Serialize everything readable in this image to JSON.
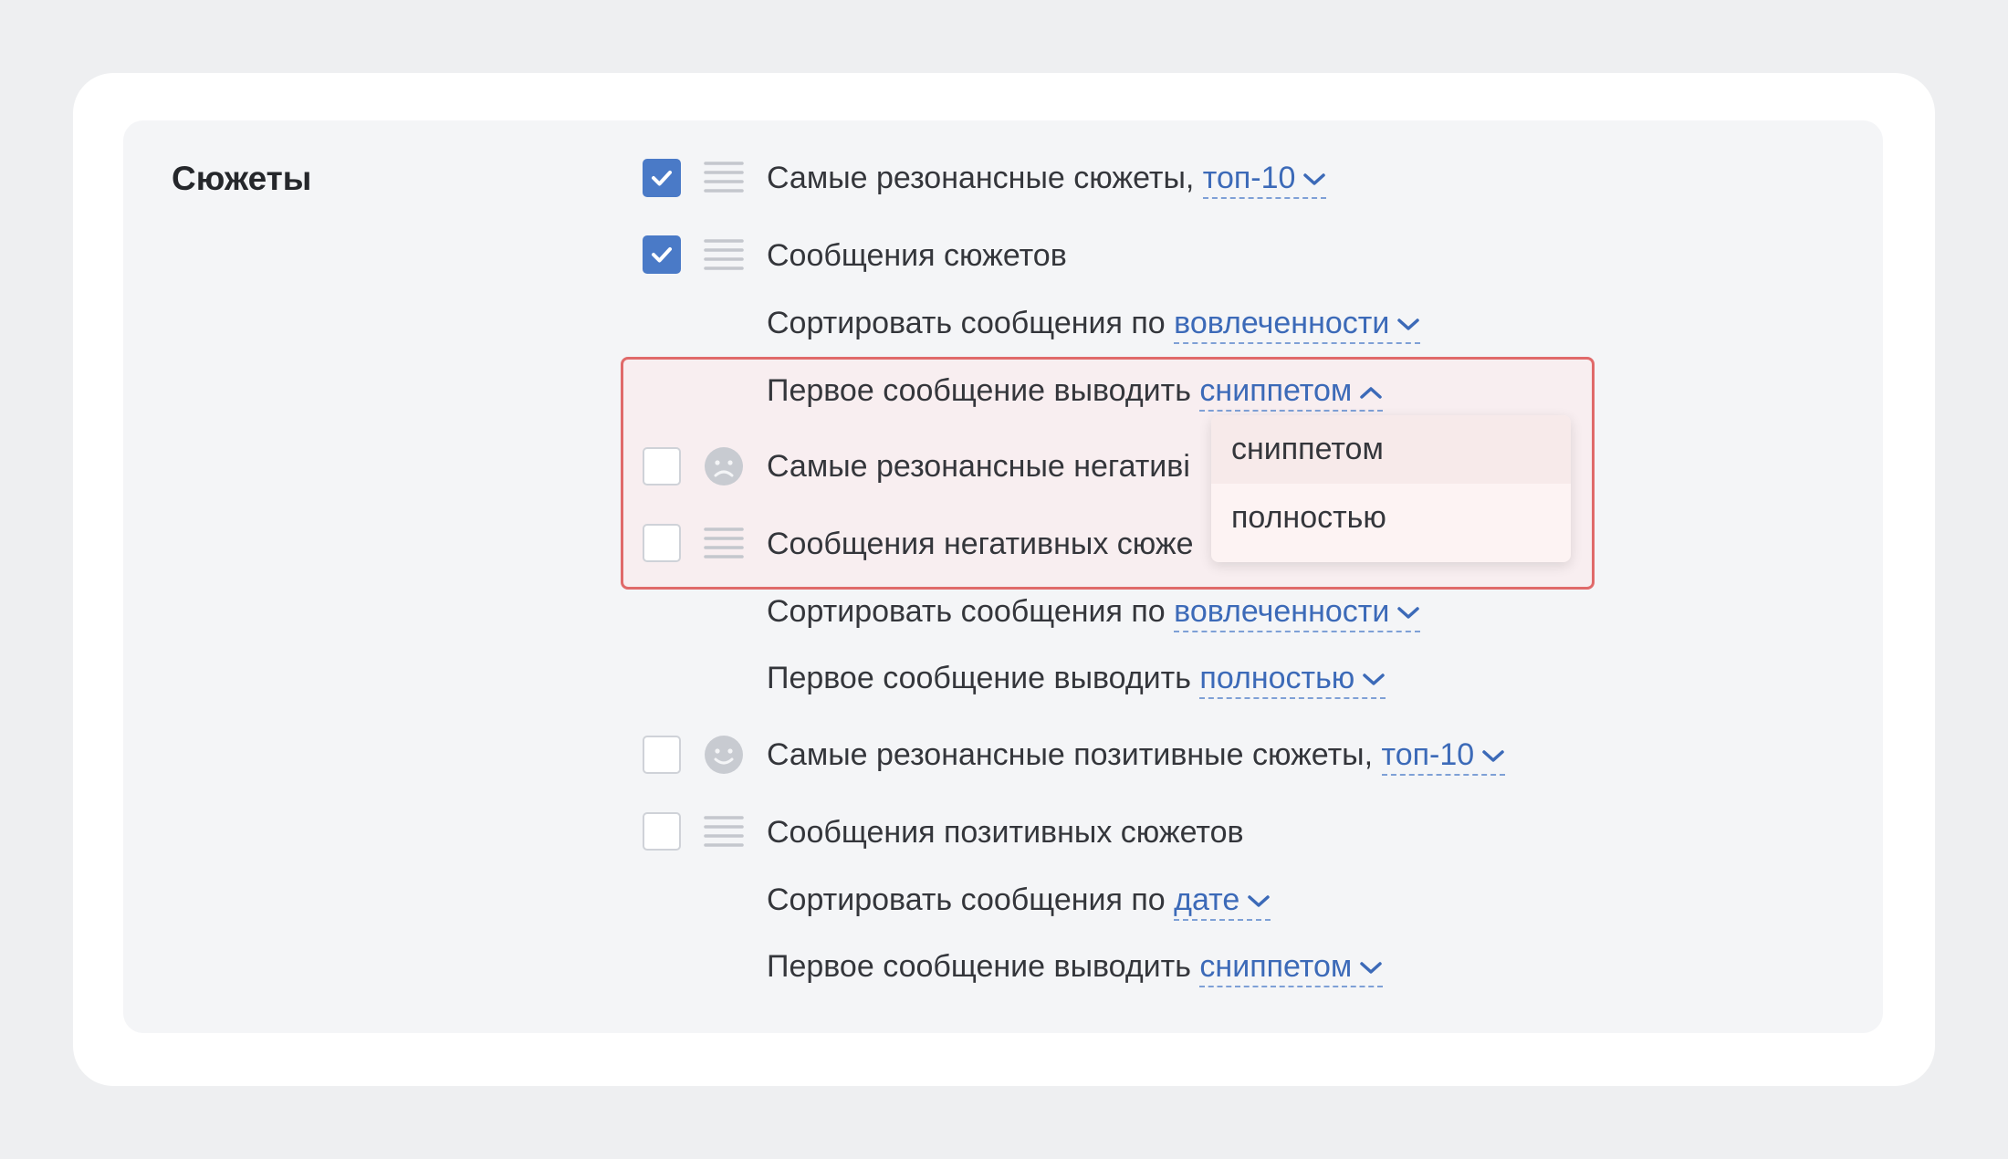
{
  "section": {
    "title": "Сюжеты"
  },
  "rows": {
    "r1": {
      "text": "Самые резонансные сюжеты,",
      "link": "топ-10",
      "checked": true
    },
    "r2": {
      "text": "Сообщения сюжетов",
      "checked": true
    },
    "r3": {
      "text": "Сортировать сообщения по",
      "link": "вовлеченности"
    },
    "r4": {
      "text": "Первое сообщение выводить",
      "link": "сниппетом"
    },
    "r5": {
      "text": "Самые резонансные негативі",
      "checked": false
    },
    "r6": {
      "text": "Сообщения негативных сюже",
      "checked": false
    },
    "r7": {
      "text": "Сортировать сообщения по",
      "link": "вовлеченности"
    },
    "r8": {
      "text": "Первое сообщение выводить",
      "link": "полностью"
    },
    "r9": {
      "text": "Самые резонансные позитивные сюжеты,",
      "link": "топ-10",
      "checked": false
    },
    "r10": {
      "text": "Сообщения позитивных сюжетов",
      "checked": false
    },
    "r11": {
      "text": "Сортировать сообщения по",
      "link": "дате"
    },
    "r12": {
      "text": "Первое сообщение выводить",
      "link": "сниппетом"
    }
  },
  "dropdown": {
    "options": [
      "сниппетом",
      "полностью"
    ],
    "selected": "сниппетом"
  },
  "icons": {
    "checked_box": "checkbox-checked-icon",
    "list": "list-lines-icon",
    "sad": "sad-face-icon",
    "smile": "smile-face-icon",
    "chevron_down": "chevron-down-icon",
    "chevron_up": "chevron-up-icon"
  },
  "colors": {
    "accent": "#4a7ac7",
    "link": "#3c6ab8",
    "highlight_border": "#e06a6a"
  }
}
